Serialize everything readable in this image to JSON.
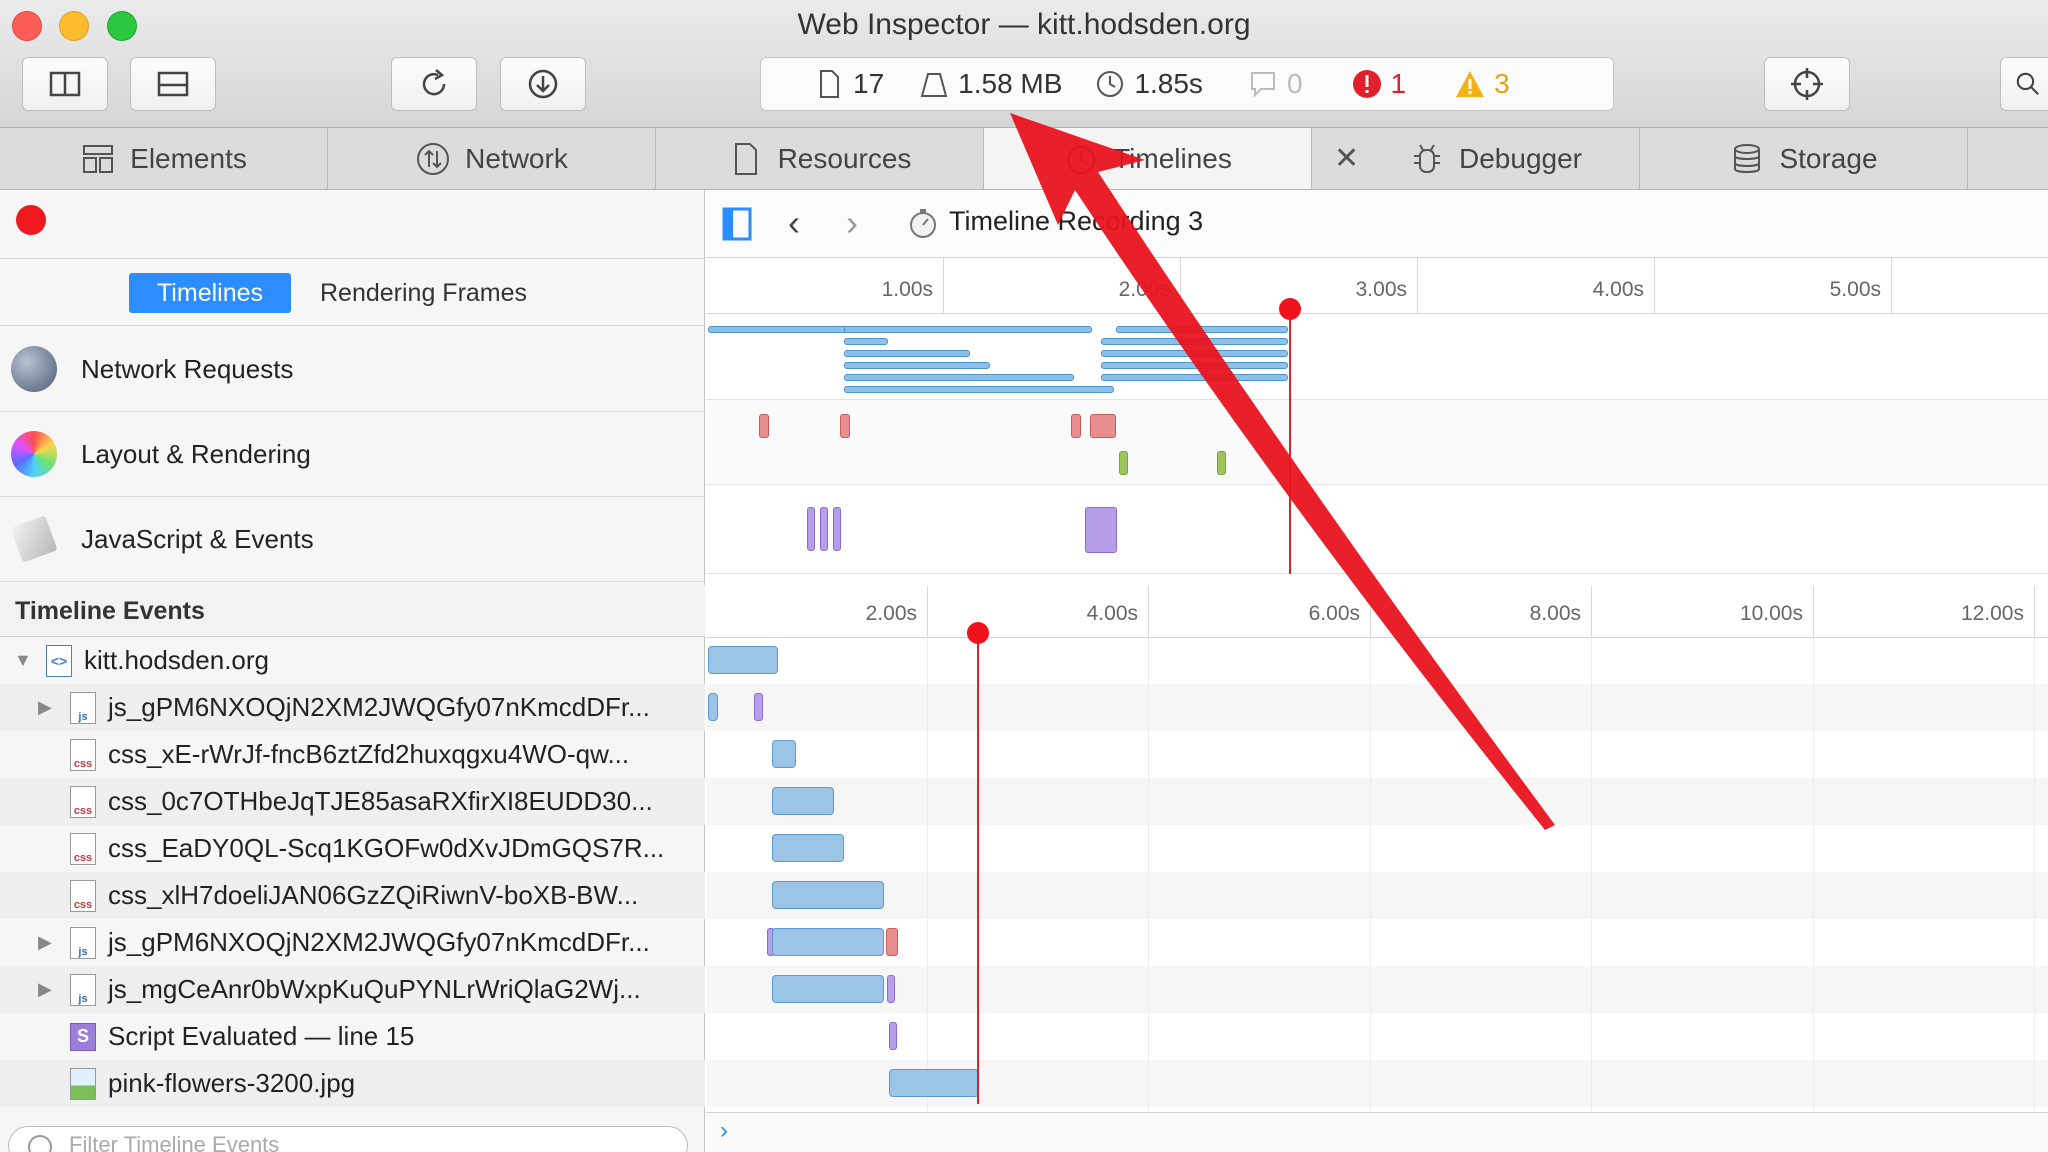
{
  "window": {
    "title": "Web Inspector — kitt.hodsden.org"
  },
  "dashboard": {
    "resources_count": "17",
    "resources_size": "1.58 MB",
    "load_time": "1.85s",
    "console_logs": "0",
    "errors": "1",
    "warnings": "3"
  },
  "tabs": [
    {
      "label": "Elements",
      "icon": "elements-icon"
    },
    {
      "label": "Network",
      "icon": "network-icon"
    },
    {
      "label": "Resources",
      "icon": "resources-icon"
    },
    {
      "label": "Timelines",
      "icon": "timelines-icon"
    },
    {
      "label": "Debugger",
      "icon": "debugger-icon"
    },
    {
      "label": "Storage",
      "icon": "storage-icon"
    }
  ],
  "nav": {
    "recording_title": "Timeline Recording 3"
  },
  "sidebar": {
    "segment_timelines": "Timelines",
    "segment_frames": "Rendering Frames",
    "tracks": [
      {
        "label": "Network Requests"
      },
      {
        "label": "Layout & Rendering"
      },
      {
        "label": "JavaScript & Events"
      }
    ],
    "events_header": "Timeline Events",
    "events": [
      {
        "name": "kitt.hodsden.org",
        "type": "doc",
        "disclosure": "open"
      },
      {
        "name": "js_gPM6NXOQjN2XM2JWQGfy07nKmcdDFr...",
        "type": "js",
        "disclosure": "closed"
      },
      {
        "name": "css_xE-rWrJf-fncB6ztZfd2huxqgxu4WO-qw...",
        "type": "css",
        "disclosure": "none"
      },
      {
        "name": "css_0c7OTHbeJqTJE85asaRXfirXI8EUDD30...",
        "type": "css",
        "disclosure": "none"
      },
      {
        "name": "css_EaDY0QL-Scq1KGOFw0dXvJDmGQS7R...",
        "type": "css",
        "disclosure": "none"
      },
      {
        "name": "css_xlH7doeliJAN06GzZQiRiwnV-boXB-BW...",
        "type": "css",
        "disclosure": "none"
      },
      {
        "name": "js_gPM6NXOQjN2XM2JWQGfy07nKmcdDFr...",
        "type": "js",
        "disclosure": "closed"
      },
      {
        "name": "js_mgCeAnr0bWxpKuQuPYNLrWriQlaG2Wj...",
        "type": "js",
        "disclosure": "closed"
      },
      {
        "name": "Script Evaluated — line 15",
        "type": "script",
        "disclosure": "none"
      },
      {
        "name": "pink-flowers-3200.jpg",
        "type": "img",
        "disclosure": "none"
      }
    ],
    "filter_placeholder": "Filter Timeline Events"
  },
  "overview_ruler": [
    "1.00s",
    "2.00s",
    "3.00s",
    "4.00s",
    "5.00s"
  ],
  "events_ruler": [
    "2.00s",
    "4.00s",
    "6.00s",
    "8.00s",
    "10.00s",
    "12.00s"
  ],
  "colors": {
    "accent": "#2c8dff",
    "record": "#f0181f",
    "annotation_arrow": "#e8141d"
  }
}
